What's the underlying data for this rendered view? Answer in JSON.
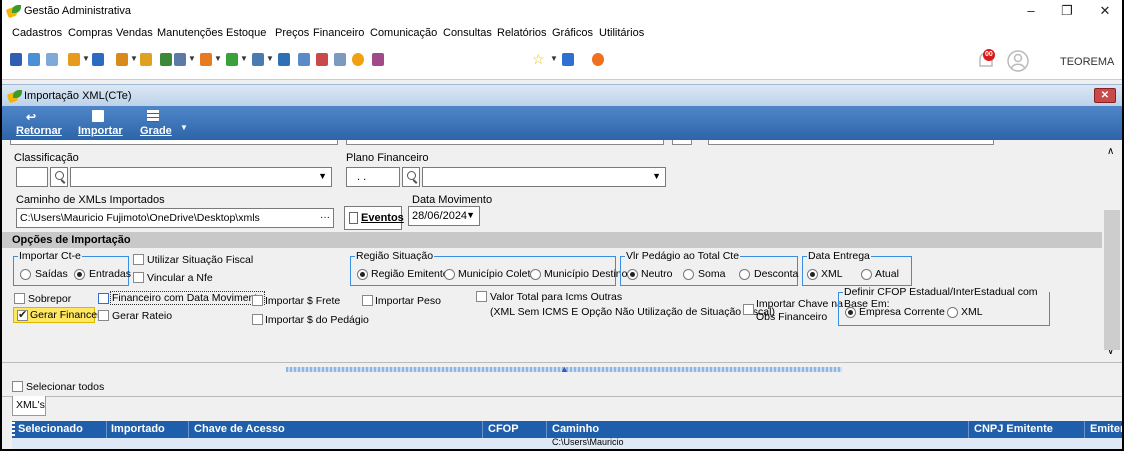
{
  "app": {
    "title": "Gestão Administrativa",
    "user": "TEOREMA",
    "notification_count": "00"
  },
  "menu": [
    "Cadastros",
    "Compras",
    "Vendas",
    "Manutenções",
    "Estoque",
    "Preços",
    "Financeiro",
    "Comunicação",
    "Consultas",
    "Relatórios",
    "Gráficos",
    "Utilitários"
  ],
  "child": {
    "title": "Importação XML(CTe)",
    "ribbon": {
      "back": "Retornar",
      "import": "Importar",
      "grid": "Grade"
    }
  },
  "form": {
    "classificacao_label": "Classificação",
    "plano_label": "Plano Financeiro",
    "plano_value": ". .",
    "caminho_label": "Caminho de XMLs Importados",
    "caminho_value": "C:\\Users\\Mauricio Fujimoto\\OneDrive\\Desktop\\xmls",
    "eventos_label": "Eventos",
    "data_mov_label": "Data Movimento",
    "data_mov_value": "28/06/2024",
    "section_title": "Opções de Importação",
    "importar_cte": {
      "title": "Importar Ct-e",
      "saidas": "Saídas",
      "entradas": "Entradas"
    },
    "utilizar_situacao": "Utilizar Situação Fiscal",
    "vincular_nfe": "Vincular a Nfe",
    "regiao": {
      "title": "Região Situação",
      "emitente": "Região Emitente",
      "coleta": "Município Coleta",
      "destino": "Município Destino"
    },
    "pedagio": {
      "title": "Vlr Pedágio ao Total Cte",
      "neutro": "Neutro",
      "soma": "Soma",
      "desconta": "Desconta"
    },
    "data_entrega": {
      "title": "Data Entrega",
      "xml": "XML",
      "atual": "Atual"
    },
    "sobrepor": "Sobrepor",
    "fin_data_mov": "Financeiro com Data Movimento",
    "importar_frete": "Importar $ Frete",
    "importar_peso": "Importar Peso",
    "valor_total_line1": "Valor Total para Icms Outras",
    "valor_total_line2": "(XML Sem ICMS E Opção Não Utilização de Situação Fiscal)",
    "gerar_financeiro": "Gerar Financeiro",
    "gerar_rateio": "Gerar Rateio",
    "importar_pedagio": "Importar $ do Pedágio",
    "importar_chave_line1": "Importar Chave na",
    "importar_chave_line2": "Obs Financeiro",
    "cfop": {
      "title": "Definir CFOP Estadual/InterEstadual com Base Em:",
      "corrente": "Empresa Corrente",
      "xml": "XML"
    }
  },
  "selecionar_todos": "Selecionar todos",
  "tab": "XML's",
  "grid": {
    "columns": [
      "Selecionado",
      "Importado",
      "Chave de Acesso",
      "CFOP",
      "Caminho",
      "CNPJ Emitente",
      "Emiter"
    ],
    "first_row_caminho": "C:\\Users\\Mauricio"
  }
}
